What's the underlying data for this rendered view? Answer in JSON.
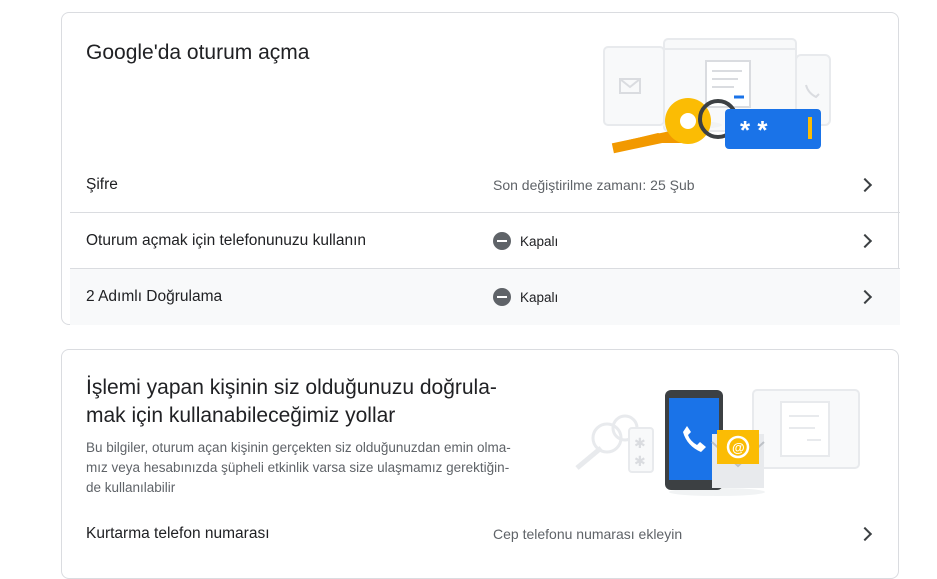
{
  "signin": {
    "title": "Google'da oturum açma",
    "rows": [
      {
        "label": "Şifre",
        "value": "Son değiştirilme zamanı: 25 Şub"
      },
      {
        "label": "Oturum açmak için telefonunuzu kullanın",
        "value": "Kapalı"
      },
      {
        "label": "2 Adımlı Doğrulama",
        "value": "Kapalı"
      }
    ]
  },
  "verify": {
    "title_line1": "İşlemi yapan kişinin siz olduğunuzu doğrula-",
    "title_line2": "mak için kullanabileceğimiz yollar",
    "desc_line1": "Bu bilgiler, oturum açan kişinin gerçekten siz olduğunuzdan emin olma-",
    "desc_line2": "mız veya hesabınızda şüpheli etkinlik varsa size ulaşmamız gerektiğin-",
    "desc_line3": "de kullanılabilir",
    "rows": [
      {
        "label": "Kurtarma telefon numarası",
        "value": "Cep telefonu numarası ekleyin"
      }
    ]
  },
  "illustration_text": {
    "password_mask": "* *"
  },
  "colors": {
    "accent_blue": "#1a73e8",
    "key_yellow": "#fbbc04",
    "key_orange": "#f29900",
    "border": "#dadce0"
  }
}
